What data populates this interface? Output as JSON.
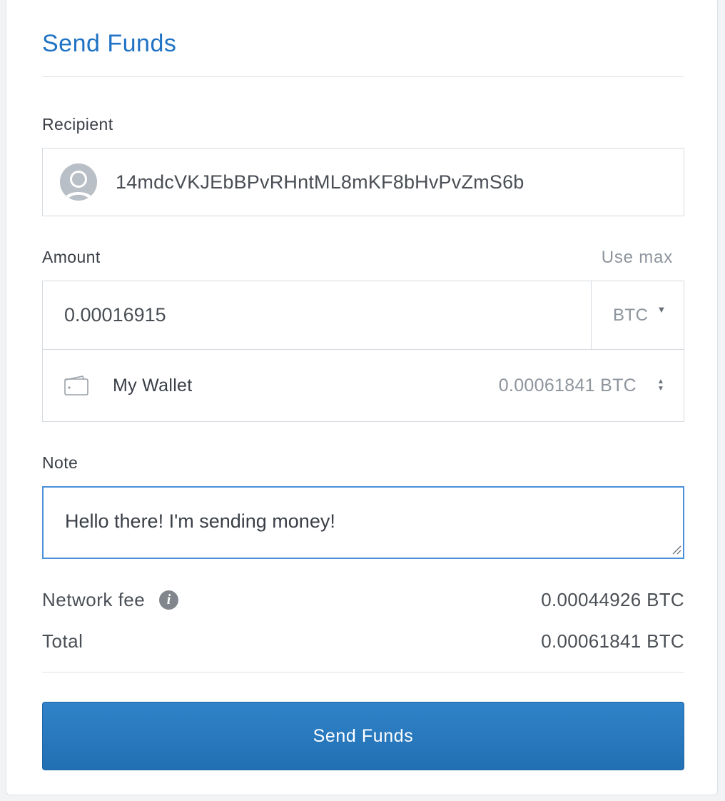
{
  "title": "Send Funds",
  "recipient": {
    "label": "Recipient",
    "address": "14mdcVKJEbBPvRHntML8mKF8bHvPvZmS6b",
    "avatar_icon": "user-avatar-icon"
  },
  "amount": {
    "label": "Amount",
    "use_max": "Use max",
    "value": "0.00016915",
    "currency": "BTC",
    "currency_caret_icon": "chevron-down-icon"
  },
  "wallet": {
    "icon": "wallet-icon",
    "name": "My Wallet",
    "balance": "0.00061841 BTC",
    "selector_icon": "updown-caret-icon"
  },
  "note": {
    "label": "Note",
    "value": "Hello there! I'm sending money!"
  },
  "summary": {
    "network_fee_label": "Network fee",
    "network_fee_info_icon": "info-icon",
    "network_fee_value": "0.00044926 BTC",
    "total_label": "Total",
    "total_value": "0.00061841 BTC"
  },
  "actions": {
    "send_label": "Send Funds"
  },
  "colors": {
    "accent": "#1f72c4",
    "button": "#2779be",
    "focus_border": "#4a90d9"
  }
}
